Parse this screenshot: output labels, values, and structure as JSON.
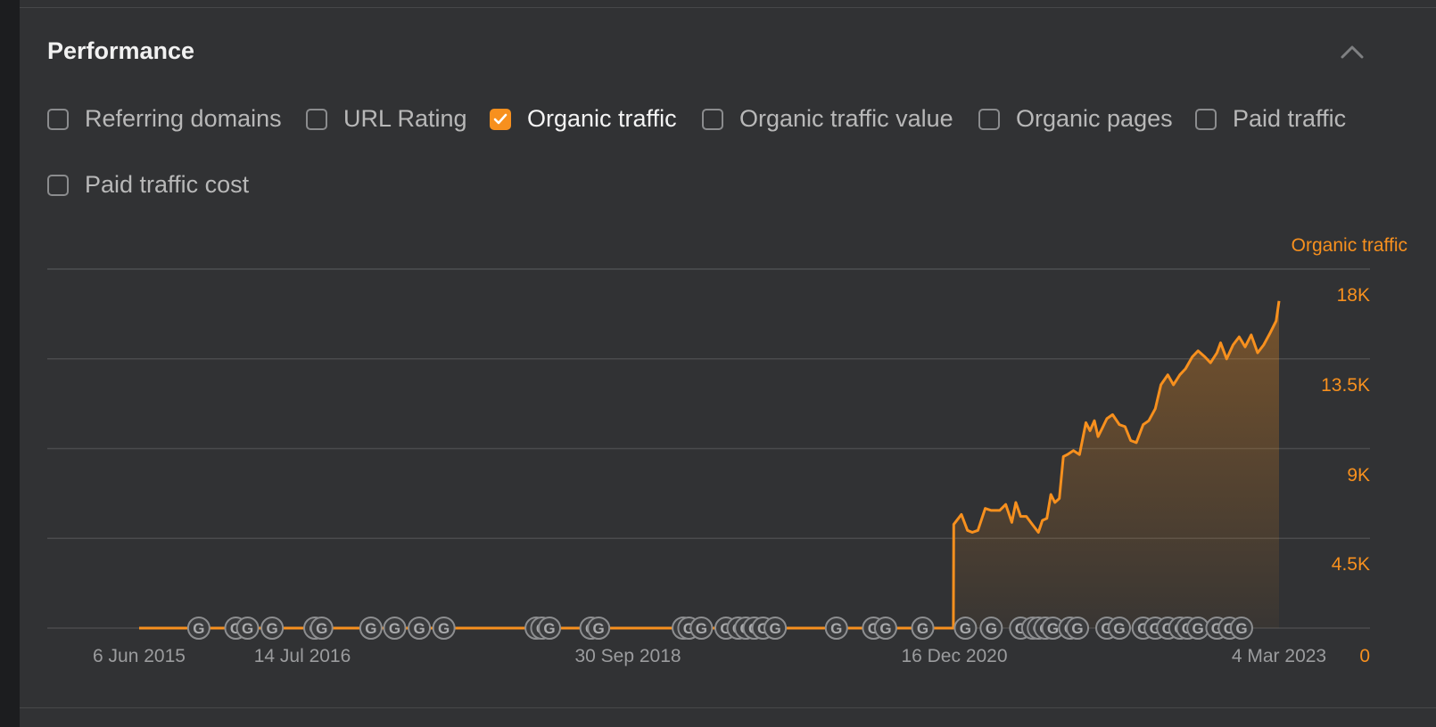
{
  "section": {
    "title": "Performance",
    "collapse_icon": "chevron-up-icon"
  },
  "filters": [
    {
      "label": "Referring domains",
      "checked": false
    },
    {
      "label": "URL Rating",
      "checked": false
    },
    {
      "label": "Organic traffic",
      "checked": true
    },
    {
      "label": "Organic traffic value",
      "checked": false
    },
    {
      "label": "Organic pages",
      "checked": false
    },
    {
      "label": "Paid traffic",
      "checked": false
    },
    {
      "label": "Paid traffic cost",
      "checked": false
    }
  ],
  "colors": {
    "accent": "#f7901e",
    "background": "#313234",
    "grid": "#4a4b4d",
    "marker": "#3a3b3d"
  },
  "chart_data": {
    "type": "area",
    "series": [
      {
        "name": "Organic traffic",
        "color": "#f7901e",
        "x": [
          "2015-06-06",
          "2020-12-16",
          "2020-12-17",
          "2021-01-05",
          "2021-01-20",
          "2021-02-01",
          "2021-02-15",
          "2021-03-05",
          "2021-03-20",
          "2021-04-10",
          "2021-04-25",
          "2021-05-10",
          "2021-05-20",
          "2021-06-01",
          "2021-06-15",
          "2021-06-30",
          "2021-07-15",
          "2021-07-25",
          "2021-08-05",
          "2021-08-15",
          "2021-08-25",
          "2021-09-05",
          "2021-09-15",
          "2021-09-25",
          "2021-10-10",
          "2021-10-25",
          "2021-11-10",
          "2021-11-20",
          "2021-12-01",
          "2021-12-10",
          "2021-12-20",
          "2022-01-01",
          "2022-01-15",
          "2022-02-01",
          "2022-02-15",
          "2022-03-01",
          "2022-03-15",
          "2022-04-01",
          "2022-04-15",
          "2022-05-01",
          "2022-05-15",
          "2022-06-01",
          "2022-06-15",
          "2022-07-01",
          "2022-07-15",
          "2022-08-01",
          "2022-08-15",
          "2022-09-01",
          "2022-09-15",
          "2022-10-01",
          "2022-10-10",
          "2022-10-25",
          "2022-11-10",
          "2022-11-25",
          "2022-12-10",
          "2022-12-25",
          "2023-01-10",
          "2023-01-25",
          "2023-02-10",
          "2023-02-25",
          "2023-03-04"
        ],
        "y": [
          0,
          0,
          5200,
          5700,
          4900,
          4800,
          4900,
          6000,
          5900,
          5900,
          6200,
          5300,
          6300,
          5600,
          5600,
          5200,
          4800,
          5400,
          5500,
          6700,
          6300,
          6500,
          8600,
          8700,
          8900,
          8700,
          10300,
          9900,
          10400,
          9600,
          10000,
          10500,
          10700,
          10200,
          10100,
          9400,
          9300,
          10200,
          10400,
          11000,
          12200,
          12700,
          12200,
          12700,
          13000,
          13600,
          13900,
          13600,
          13300,
          13800,
          14300,
          13500,
          14200,
          14600,
          14100,
          14700,
          13800,
          14200,
          14800,
          15400,
          16400
        ]
      }
    ],
    "x_ticks": [
      "6 Jun 2015",
      "14 Jul 2016",
      "30 Sep 2018",
      "16 Dec 2020",
      "4 Mar 2023"
    ],
    "y_ticks": [
      "0",
      "4.5K",
      "9K",
      "13.5K",
      "18K"
    ],
    "ylim": [
      0,
      18000
    ],
    "xlim": [
      "2015-06-06",
      "2023-03-04"
    ],
    "grid": true,
    "legend": "top-right",
    "annotations": {
      "type": "google-update-markers",
      "label": "G",
      "dates": [
        "2015-11-01",
        "2016-02-01",
        "2016-03-01",
        "2016-05-01",
        "2016-08-15",
        "2016-09-01",
        "2017-01-01",
        "2017-03-01",
        "2017-05-01",
        "2017-07-01",
        "2018-02-15",
        "2018-03-01",
        "2018-03-20",
        "2018-07-01",
        "2018-07-20",
        "2019-02-15",
        "2019-03-01",
        "2019-04-01",
        "2019-06-01",
        "2019-07-01",
        "2019-07-20",
        "2019-08-10",
        "2019-09-01",
        "2019-10-01",
        "2020-03-01",
        "2020-06-01",
        "2020-07-01",
        "2020-10-01",
        "2021-01-15",
        "2021-03-20",
        "2021-06-01",
        "2021-07-01",
        "2021-07-15",
        "2021-08-01",
        "2021-08-20",
        "2021-10-01",
        "2021-10-20",
        "2022-01-01",
        "2022-02-01",
        "2022-04-01",
        "2022-05-01",
        "2022-06-01",
        "2022-07-01",
        "2022-07-20",
        "2022-08-15",
        "2022-10-01",
        "2022-11-01",
        "2022-12-01"
      ]
    }
  }
}
